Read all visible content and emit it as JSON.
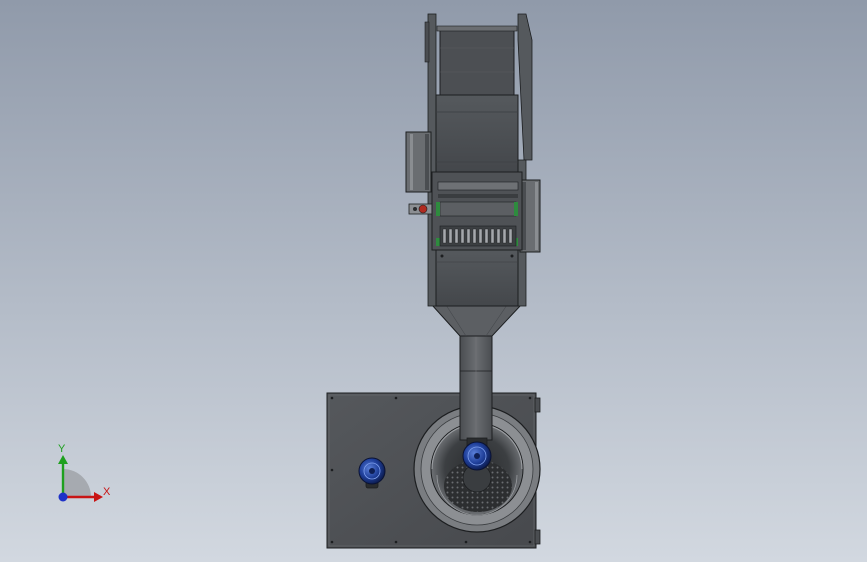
{
  "triad": {
    "x_label": "X",
    "y_label": "Y",
    "x_color": "#c81414",
    "y_color": "#1ea01e",
    "z_color": "#1e32c8"
  },
  "colors": {
    "background_top": "#909aaa",
    "background_bottom": "#d2d8e0",
    "part_fill": "#5a5e62",
    "part_dark": "#3a3d40",
    "part_light": "#86898d",
    "outline": "#1c1e20",
    "motor_blue": "#1f3f9a",
    "accent_green": "#2e8b3e",
    "accent_red": "#b02a20"
  }
}
